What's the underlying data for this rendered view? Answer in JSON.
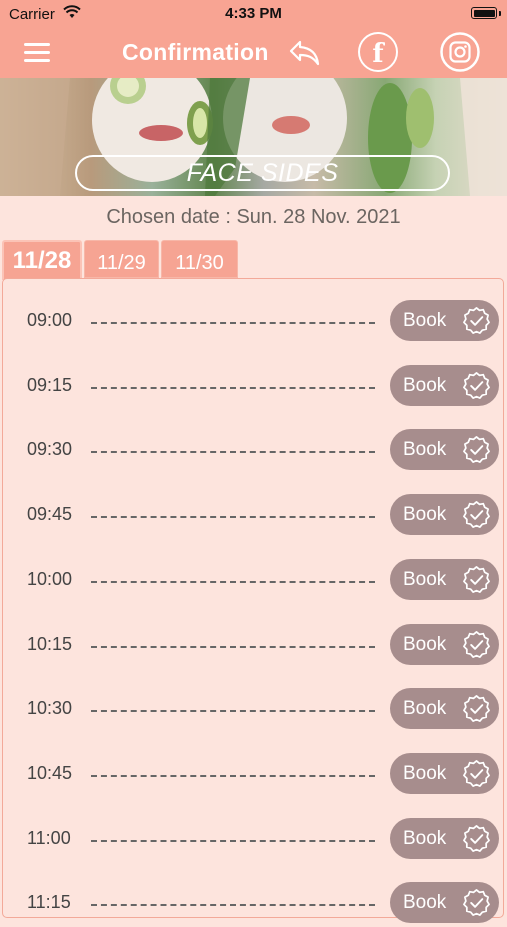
{
  "status": {
    "carrier": "Carrier",
    "time": "4:33 PM"
  },
  "nav": {
    "title": "Confirmation"
  },
  "banner": {
    "label": "FACE SIDES"
  },
  "chosen_date": "Chosen date : Sun. 28 Nov. 2021",
  "tabs": [
    "11/28",
    "11/29",
    "11/30"
  ],
  "book_label": "Book",
  "slots": [
    "09:00",
    "09:15",
    "09:30",
    "09:45",
    "10:00",
    "10:15",
    "10:30",
    "10:45",
    "11:00",
    "11:15"
  ],
  "colors": {
    "header": "#f8a493",
    "background": "#fde4dd",
    "book_button": "#a78d8d",
    "tab": "#f6a493"
  },
  "icons": [
    "menu-icon",
    "back-arrow-icon",
    "facebook-icon",
    "instagram-icon",
    "check-badge-icon",
    "wifi-icon",
    "battery-icon"
  ]
}
